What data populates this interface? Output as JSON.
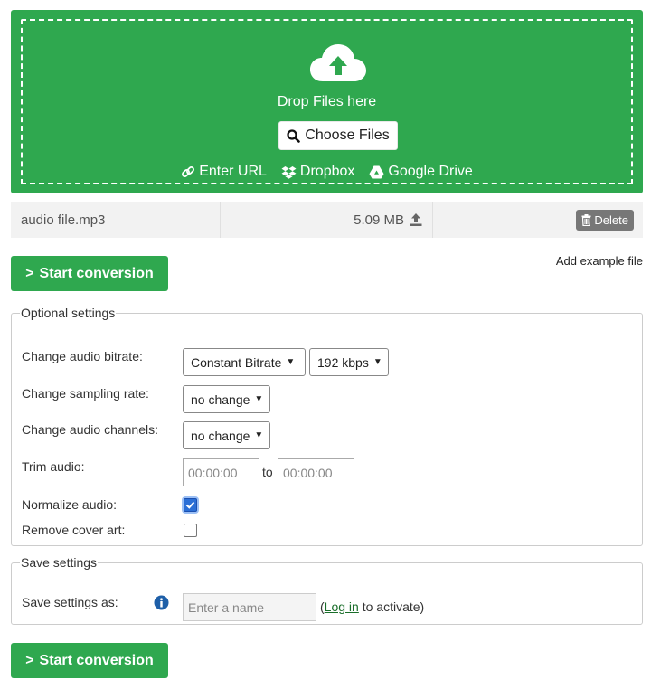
{
  "dropzone": {
    "text": "Drop Files here",
    "choose_label": "Choose Files",
    "links": [
      {
        "label": "Enter URL",
        "icon": "link-icon"
      },
      {
        "label": "Dropbox",
        "icon": "dropbox-icon"
      },
      {
        "label": "Google Drive",
        "icon": "google-drive-icon"
      }
    ]
  },
  "file": {
    "name": "audio file.mp3",
    "size": "5.09 MB",
    "delete_label": "Delete"
  },
  "actions": {
    "start_label": "Start conversion",
    "example_label": "Add example file"
  },
  "optional": {
    "legend": "Optional settings",
    "bitrate_label": "Change audio bitrate:",
    "bitrate_mode": "Constant Bitrate",
    "bitrate_value": "192 kbps",
    "sampling_label": "Change sampling rate:",
    "sampling_value": "no change",
    "channels_label": "Change audio channels:",
    "channels_value": "no change",
    "trim_label": "Trim audio:",
    "trim_from_placeholder": "00:00:00",
    "trim_to": "to",
    "trim_to_placeholder": "00:00:00",
    "normalize_label": "Normalize audio:",
    "normalize_checked": true,
    "cover_label": "Remove cover art:",
    "cover_checked": false
  },
  "save": {
    "legend": "Save settings",
    "label": "Save settings as:",
    "placeholder": "Enter a name",
    "paren_open": "(",
    "login_link": "Log in",
    "suffix": " to activate)"
  },
  "colors": {
    "brand_green": "#2fa84f",
    "checkbox_blue": "#2b6fd6",
    "info_blue": "#1e5fa8"
  }
}
